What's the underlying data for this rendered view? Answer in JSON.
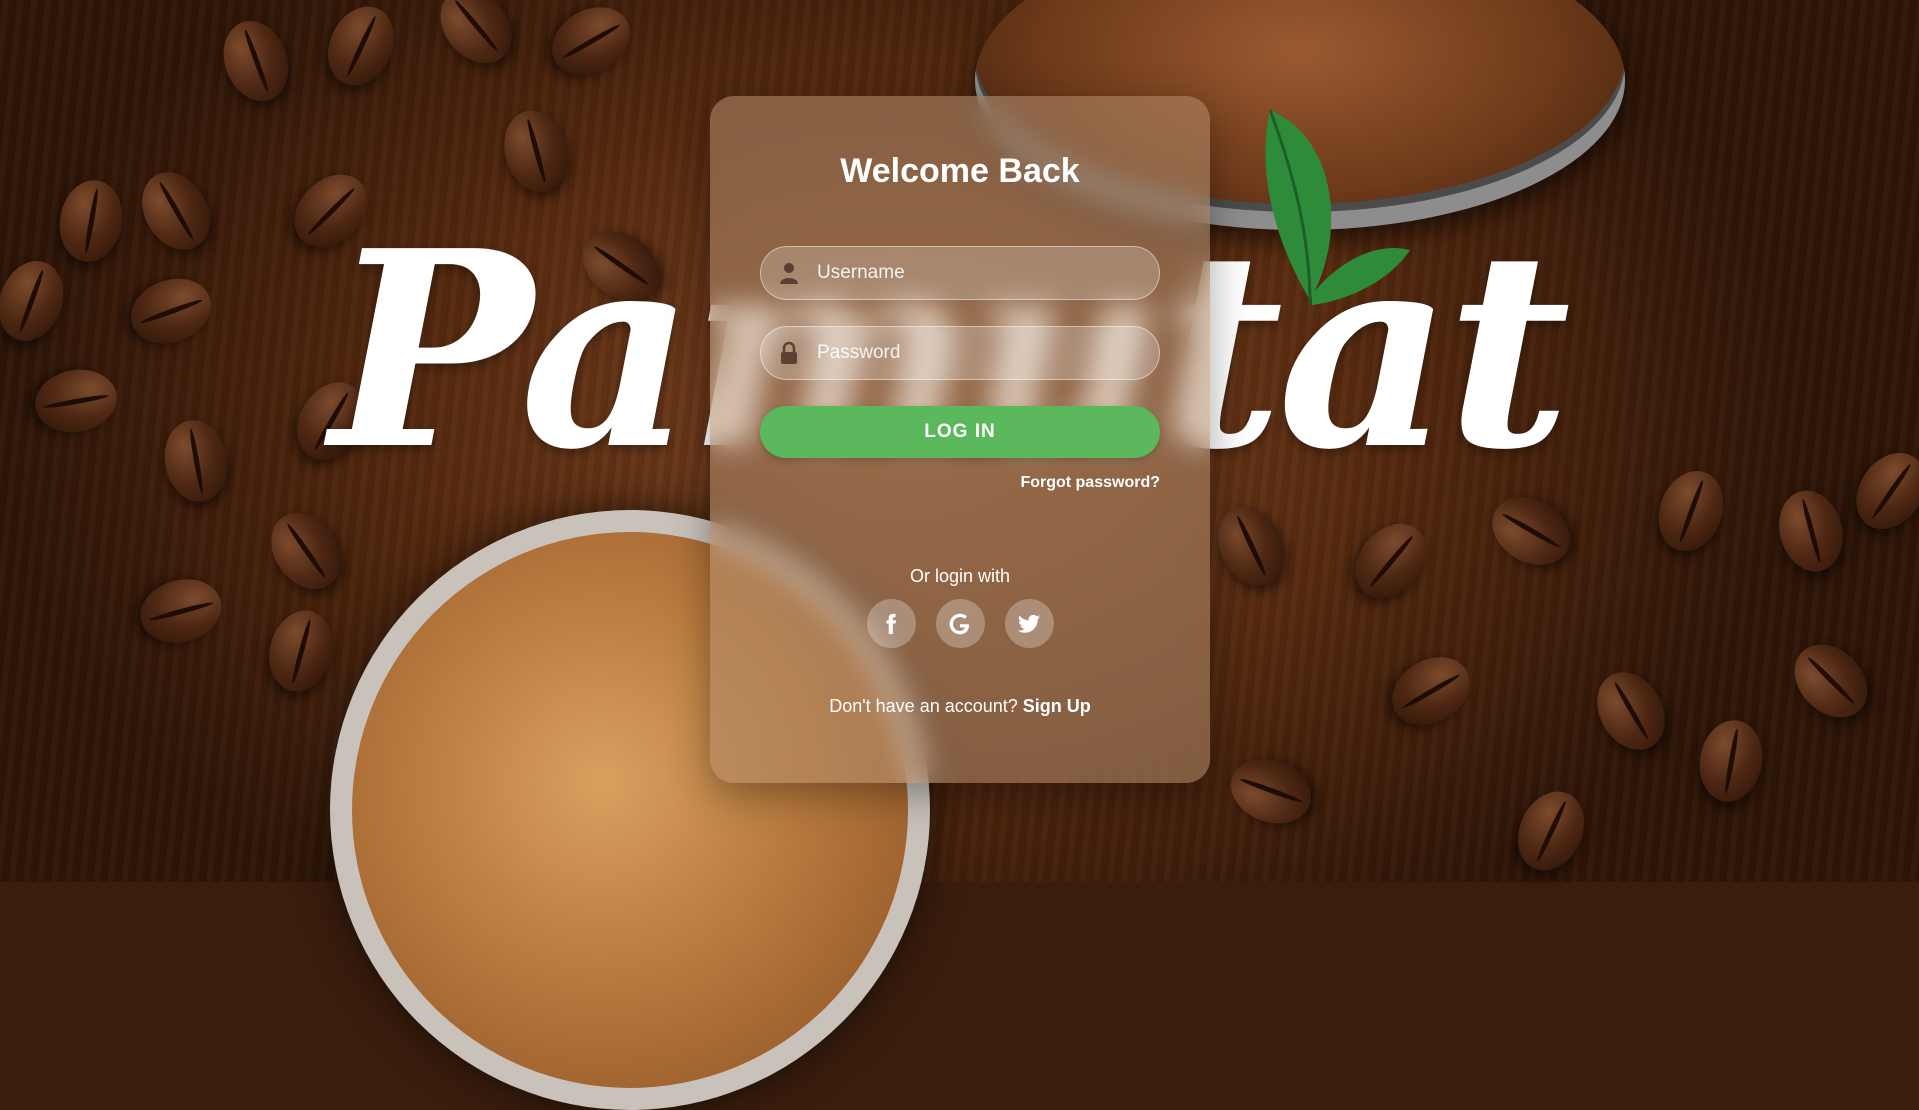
{
  "brand": {
    "wordmark": "Pamutat"
  },
  "login": {
    "title": "Welcome Back",
    "username_placeholder": "Username",
    "password_placeholder": "Password",
    "login_button": "LOG IN",
    "forgot_password": "Forgot password?",
    "or_login_with": "Or login with",
    "socials": [
      {
        "icon": "facebook-icon"
      },
      {
        "icon": "google-icon"
      },
      {
        "icon": "twitter-icon"
      }
    ],
    "signup_prompt": "Don't have an account?",
    "signup_link": "Sign Up"
  },
  "colors": {
    "accent": "#5cb85c",
    "leaf": "#2e8b3a",
    "text": "#ffffff"
  }
}
